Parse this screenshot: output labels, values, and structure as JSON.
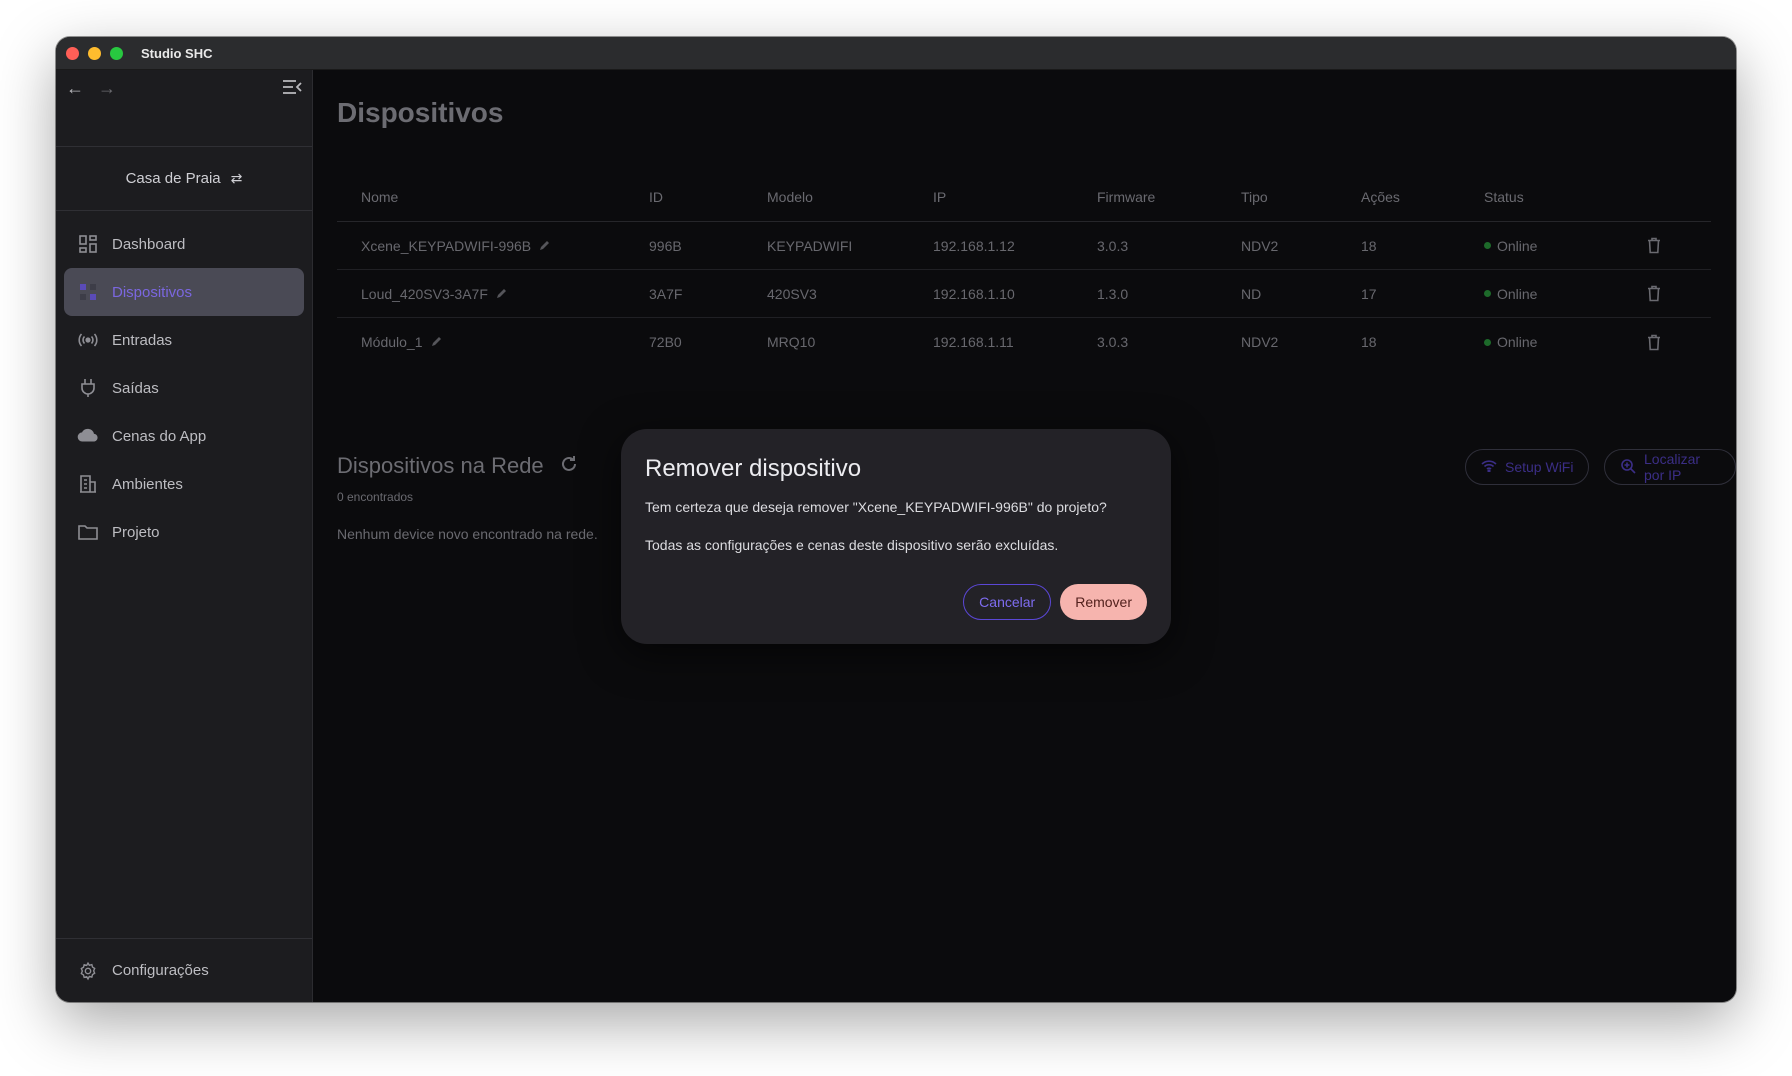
{
  "window": {
    "title": "Studio SHC"
  },
  "sidebar": {
    "project": "Casa de Praia",
    "items": [
      {
        "label": "Dashboard",
        "icon": "dashboard-icon"
      },
      {
        "label": "Dispositivos",
        "icon": "devices-icon",
        "active": true
      },
      {
        "label": "Entradas",
        "icon": "broadcast-icon"
      },
      {
        "label": "Saídas",
        "icon": "plug-icon"
      },
      {
        "label": "Cenas do App",
        "icon": "cloud-icon"
      },
      {
        "label": "Ambientes",
        "icon": "building-icon"
      },
      {
        "label": "Projeto",
        "icon": "folder-icon"
      }
    ],
    "settings_label": "Configurações"
  },
  "main": {
    "title": "Dispositivos",
    "table": {
      "headers": [
        "Nome",
        "ID",
        "Modelo",
        "IP",
        "Firmware",
        "Tipo",
        "Ações",
        "Status"
      ],
      "rows": [
        {
          "nome": "Xcene_KEYPADWIFI-996B",
          "id": "996B",
          "modelo": "KEYPADWIFI",
          "ip": "192.168.1.12",
          "firmware": "3.0.3",
          "tipo": "NDV2",
          "acoes": "18",
          "status": "Online"
        },
        {
          "nome": "Loud_420SV3-3A7F",
          "id": "3A7F",
          "modelo": "420SV3",
          "ip": "192.168.1.10",
          "firmware": "1.3.0",
          "tipo": "ND",
          "acoes": "17",
          "status": "Online"
        },
        {
          "nome": "Módulo_1",
          "id": "72B0",
          "modelo": "MRQ10",
          "ip": "192.168.1.11",
          "firmware": "3.0.3",
          "tipo": "NDV2",
          "acoes": "18",
          "status": "Online"
        }
      ]
    },
    "network": {
      "title": "Dispositivos na Rede",
      "count": "0 encontrados",
      "empty": "Nenhum device novo encontrado na rede.",
      "setup_wifi": "Setup WiFi",
      "find_by_ip": "Localizar por IP"
    }
  },
  "modal": {
    "title": "Remover dispositivo",
    "message": "Tem certeza que deseja remover \"Xcene_KEYPADWIFI-996B\" do projeto?",
    "warning": "Todas as configurações e cenas deste dispositivo serão excluídas.",
    "cancel": "Cancelar",
    "confirm": "Remover"
  },
  "colors": {
    "accent": "#7e6cf0",
    "danger_button": "#f6b4ae",
    "online": "#1d6a2a",
    "sidebar_bg": "#1c1c1f",
    "main_bg": "#0b0b0d"
  }
}
